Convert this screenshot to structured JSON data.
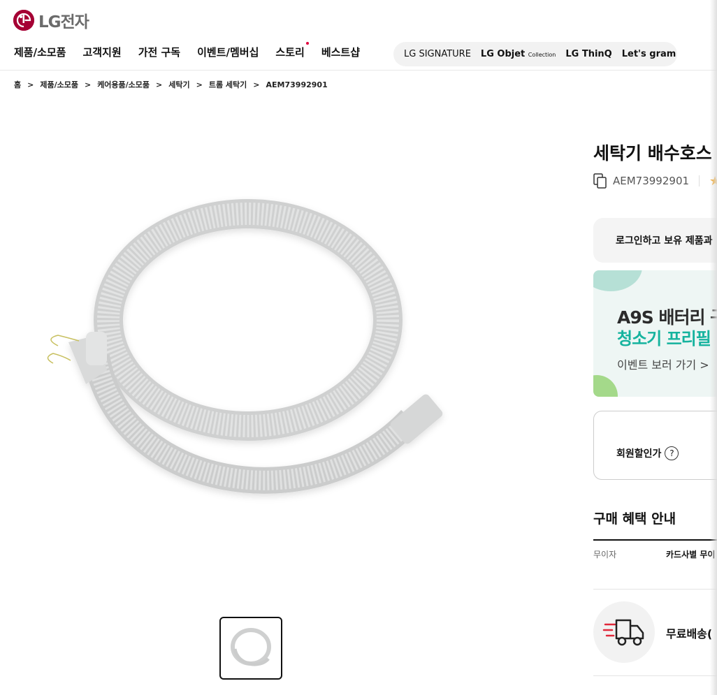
{
  "header": {
    "logo_text": "LG전자",
    "nav": [
      "제품/소모품",
      "고객지원",
      "가전 구독",
      "이벤트/멤버십",
      "스토리",
      "베스트샵"
    ],
    "brands": {
      "signature": "LG SIGNATURE",
      "objet": "LG Objet",
      "objet_sub": "Collection",
      "thinq": "LG ThinQ",
      "gram": "Let's gram"
    }
  },
  "breadcrumb": [
    "홈",
    "제품/소모품",
    "케어용품/소모품",
    "세탁기",
    "트롬 세탁기",
    "AEM73992901"
  ],
  "product": {
    "title": "세탁기 배수호스",
    "model": "AEM73992901"
  },
  "login_prompt": "로그인하고 보유 제품과",
  "banner": {
    "line1": "A9S 배터리 구",
    "line2": "청소기 프리필",
    "link": "이벤트 보러 가기 >"
  },
  "price": {
    "member_discount": "회원할인가",
    "help_symbol": "?"
  },
  "benefits": {
    "title": "구매 혜택 안내",
    "row_label": "무이자",
    "row_value": "카드사별 무이"
  },
  "delivery": {
    "label": "무료배송("
  },
  "colors": {
    "brand_red": "#a50034",
    "accent_teal": "#15b39e",
    "star": "#f5a623"
  }
}
